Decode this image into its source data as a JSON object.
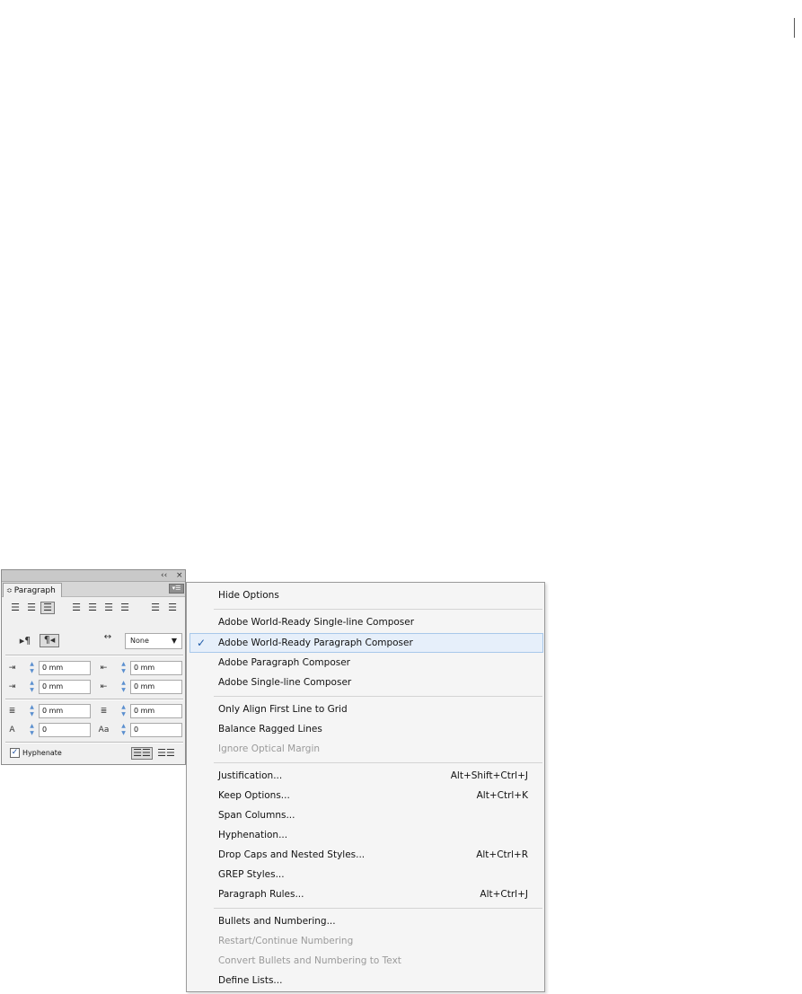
{
  "panel": {
    "title": "Paragraph",
    "tab_arrows": "≎",
    "collapse_label": "‹‹",
    "close_label": "×",
    "menu_button_label": "▾☰",
    "alignment_icons": [
      "align-left-icon",
      "align-center-icon",
      "align-right-icon",
      "justify-left-icon",
      "justify-center-icon",
      "justify-right-icon",
      "justify-all-icon",
      "align-toward-spine-icon",
      "align-away-from-spine-icon"
    ],
    "direction_icons": [
      "left-to-right-paragraph-icon",
      "right-to-left-paragraph-icon"
    ],
    "drop_cap_dropdown": {
      "value": "None",
      "arrow": "▼"
    },
    "fields": {
      "left_indent": "0 mm",
      "right_indent": "0 mm",
      "first_line_indent": "0 mm",
      "last_line_indent": "0 mm",
      "space_before": "0 mm",
      "space_after": "0 mm",
      "drop_cap_lines": "0",
      "drop_cap_characters": "0"
    },
    "hyphenate": {
      "label": "Hyphenate",
      "checked": true,
      "check_glyph": "✓"
    }
  },
  "menu": {
    "check_glyph": "✓",
    "items": [
      {
        "label": "Hide Options",
        "shortcut": "",
        "disabled": false
      },
      {
        "label": "Adobe World-Ready Single-line Composer",
        "shortcut": "",
        "disabled": false
      },
      {
        "label": "Adobe World-Ready Paragraph Composer",
        "shortcut": "",
        "disabled": false,
        "checked": true
      },
      {
        "label": "Adobe Paragraph Composer",
        "shortcut": "",
        "disabled": false
      },
      {
        "label": "Adobe Single-line Composer",
        "shortcut": "",
        "disabled": false
      },
      {
        "label": "Only Align First Line to Grid",
        "shortcut": "",
        "disabled": false
      },
      {
        "label": "Balance Ragged Lines",
        "shortcut": "",
        "disabled": false
      },
      {
        "label": "Ignore Optical Margin",
        "shortcut": "",
        "disabled": true
      },
      {
        "label": "Justification...",
        "shortcut": "Alt+Shift+Ctrl+J",
        "disabled": false
      },
      {
        "label": "Keep Options...",
        "shortcut": "Alt+Ctrl+K",
        "disabled": false
      },
      {
        "label": "Span Columns...",
        "shortcut": "",
        "disabled": false
      },
      {
        "label": "Hyphenation...",
        "shortcut": "",
        "disabled": false
      },
      {
        "label": "Drop Caps and Nested Styles...",
        "shortcut": "Alt+Ctrl+R",
        "disabled": false
      },
      {
        "label": "GREP Styles...",
        "shortcut": "",
        "disabled": false
      },
      {
        "label": "Paragraph Rules...",
        "shortcut": "Alt+Ctrl+J",
        "disabled": false
      },
      {
        "label": "Bullets and Numbering...",
        "shortcut": "",
        "disabled": false
      },
      {
        "label": "Restart/Continue Numbering",
        "shortcut": "",
        "disabled": true
      },
      {
        "label": "Convert Bullets and Numbering to Text",
        "shortcut": "",
        "disabled": true
      },
      {
        "label": "Define Lists...",
        "shortcut": "",
        "disabled": false
      }
    ]
  }
}
